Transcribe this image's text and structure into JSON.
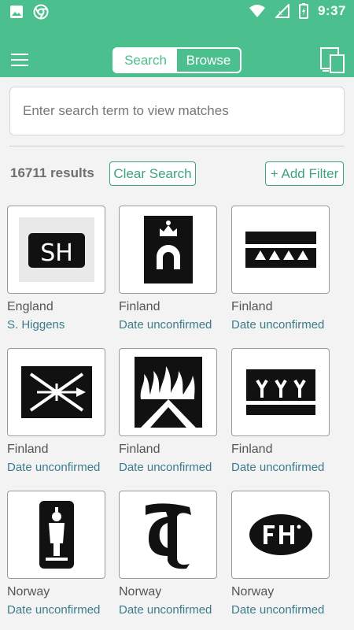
{
  "status_bar": {
    "time": "9:37",
    "icons": [
      "image-icon",
      "chrome-icon",
      "wifi-icon",
      "signal-icon",
      "battery-icon"
    ]
  },
  "app_bar": {
    "menu_icon": "hamburger-icon",
    "tabs": [
      {
        "label": "Search",
        "active": true
      },
      {
        "label": "Browse",
        "active": false
      }
    ],
    "right_icon": "device-icon",
    "color": "#4bbf8e"
  },
  "search": {
    "placeholder": "Enter search term to view matches",
    "value": ""
  },
  "results": {
    "count_text": "16711 results",
    "clear_label": "Clear Search",
    "filter_label": "+ Add Filter"
  },
  "marks": [
    {
      "country": "England",
      "maker": "S. Higgens",
      "image": "sh-mark"
    },
    {
      "country": "Finland",
      "maker": "Date unconfirmed",
      "image": "crown-horseshoe-mark"
    },
    {
      "country": "Finland",
      "maker": "Date unconfirmed",
      "image": "triangles-mark"
    },
    {
      "country": "Finland",
      "maker": "Date unconfirmed",
      "image": "crossed-swords-mark"
    },
    {
      "country": "Finland",
      "maker": "Date unconfirmed",
      "image": "flames-mark"
    },
    {
      "country": "Finland",
      "maker": "Date unconfirmed",
      "image": "trees-mark"
    },
    {
      "country": "Norway",
      "maker": "Date unconfirmed",
      "image": "figure-mark"
    },
    {
      "country": "Norway",
      "maker": "Date unconfirmed",
      "image": "script-letter-mark"
    },
    {
      "country": "Norway",
      "maker": "Date unconfirmed",
      "image": "fh-oval-mark"
    }
  ]
}
